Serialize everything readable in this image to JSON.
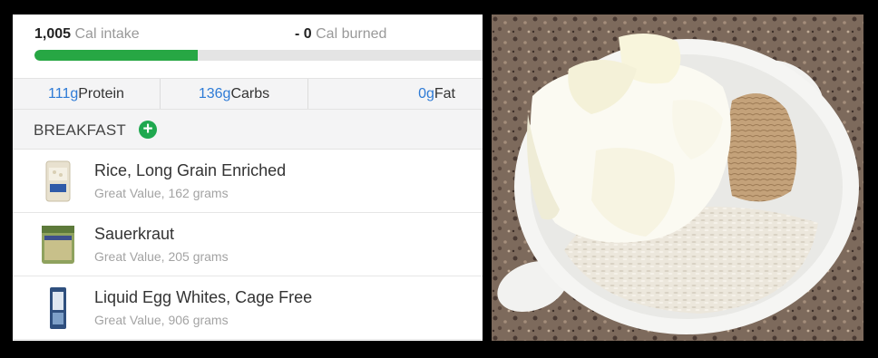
{
  "summary": {
    "intake_value": "1,005",
    "intake_label": " Cal intake",
    "burned_value": "- 0",
    "burned_label": " Cal burned",
    "progress_fraction": 0.36
  },
  "macros": {
    "protein_value": "111g",
    "protein_label": " Protein",
    "carbs_value": "136g",
    "carbs_label": " Carbs",
    "fat_value": "0g",
    "fat_label": " Fat"
  },
  "meal": {
    "title": "BREAKFAST",
    "add_icon": "plus-circle-icon",
    "items": [
      {
        "name": "Rice, Long Grain Enriched",
        "detail": "Great Value, 162 grams"
      },
      {
        "name": "Sauerkraut",
        "detail": "Great Value, 205 grams"
      },
      {
        "name": "Liquid Egg Whites, Cage Free",
        "detail": "Great Value, 906 grams"
      }
    ]
  },
  "colors": {
    "progress": "#27a744",
    "macro_number": "#2e7bd6",
    "add_button": "#1fa84f"
  }
}
